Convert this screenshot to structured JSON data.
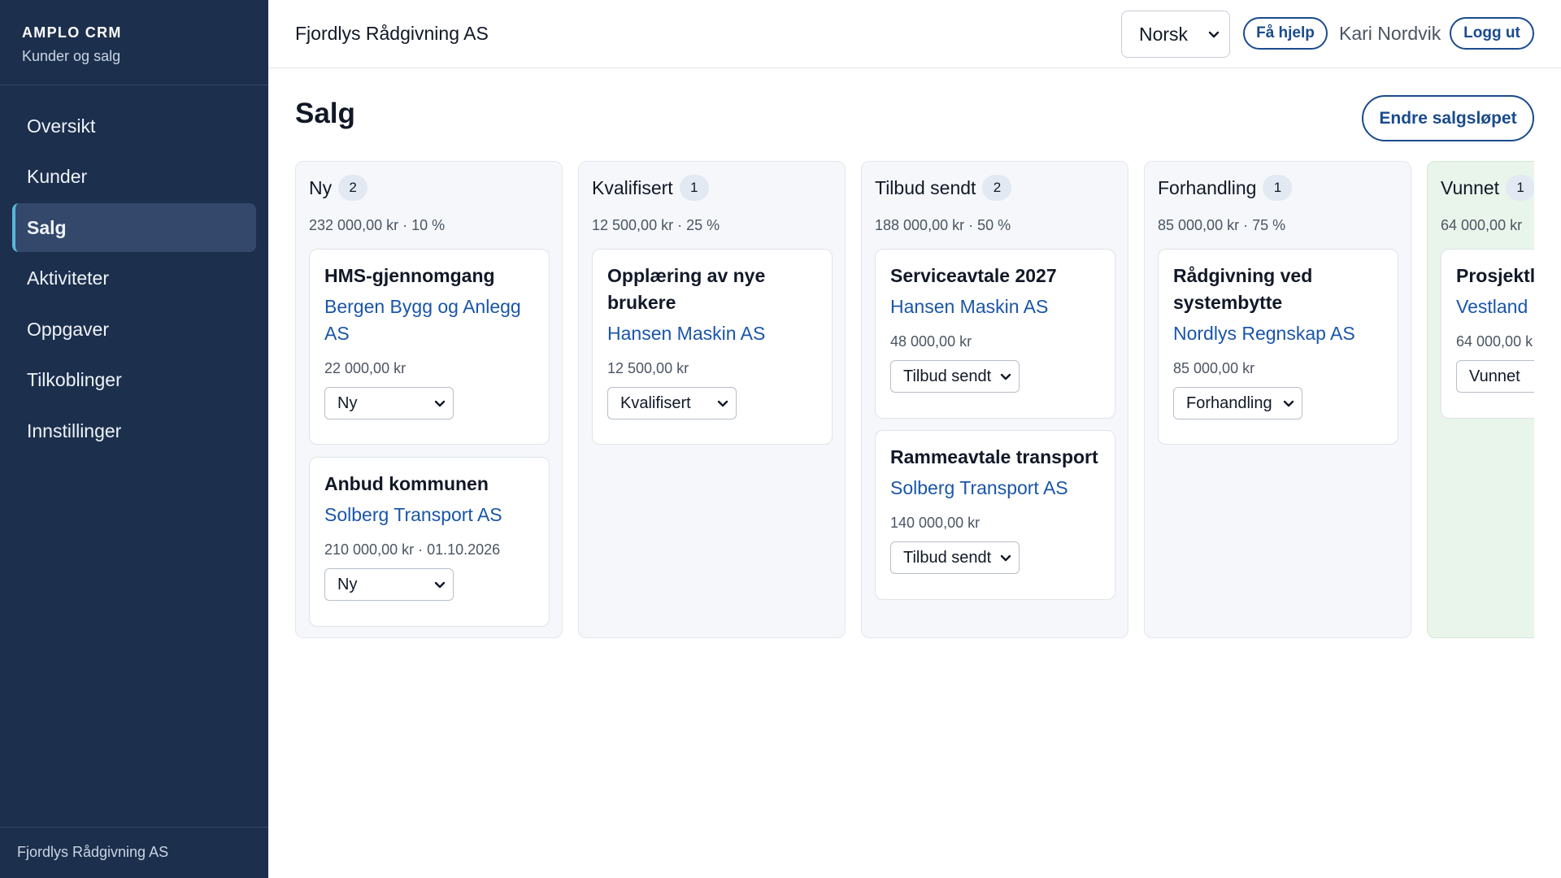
{
  "sidebar": {
    "brand_name": "AMPLO CRM",
    "brand_sub": "Kunder og salg",
    "items": [
      {
        "label": "Oversikt"
      },
      {
        "label": "Kunder"
      },
      {
        "label": "Salg",
        "active": true
      },
      {
        "label": "Aktiviteter"
      },
      {
        "label": "Oppgaver"
      },
      {
        "label": "Tilkoblinger"
      },
      {
        "label": "Innstillinger"
      }
    ],
    "footer": "Fjordlys Rådgivning AS"
  },
  "header": {
    "company": "Fjordlys Rådgivning AS",
    "language": "Norsk",
    "help_label": "Få hjelp",
    "user_name": "Kari Nordvik",
    "logout_label": "Logg ut"
  },
  "main": {
    "title": "Salg",
    "edit_pipeline_label": "Endre salgsløpet"
  },
  "board": {
    "columns": [
      {
        "title": "Ny",
        "count": "2",
        "summary": "232 000,00 kr · 10 %",
        "cards": [
          {
            "title": "HMS-gjennomgang",
            "customer": "Bergen Bygg og Anlegg AS",
            "meta": "22 000,00 kr",
            "stage": "Ny"
          },
          {
            "title": "Anbud kommunen",
            "customer": "Solberg Transport AS",
            "meta": "210 000,00 kr · 01.10.2026",
            "stage": "Ny"
          }
        ]
      },
      {
        "title": "Kvalifisert",
        "count": "1",
        "summary": "12 500,00 kr · 25 %",
        "cards": [
          {
            "title": "Opplæring av nye brukere",
            "customer": "Hansen Maskin AS",
            "meta": "12 500,00 kr",
            "stage": "Kvalifisert"
          }
        ]
      },
      {
        "title": "Tilbud sendt",
        "count": "2",
        "summary": "188 000,00 kr · 50 %",
        "cards": [
          {
            "title": "Serviceavtale 2027",
            "customer": "Hansen Maskin AS",
            "meta": "48 000,00 kr",
            "stage": "Tilbud sendt"
          },
          {
            "title": "Rammeavtale transport",
            "customer": "Solberg Transport AS",
            "meta": "140 000,00 kr",
            "stage": "Tilbud sendt"
          }
        ]
      },
      {
        "title": "Forhandling",
        "count": "1",
        "summary": "85 000,00 kr · 75 %",
        "cards": [
          {
            "title": "Rådgivning ved systembytte",
            "customer": "Nordlys Regnskap AS",
            "meta": "85 000,00 kr",
            "stage": "Forhandling"
          }
        ]
      },
      {
        "title": "Vunnet",
        "count": "1",
        "summary": "64 000,00 kr",
        "cards": [
          {
            "title": "Prosjektle",
            "customer": "Vestland E",
            "meta": "64 000,00 k",
            "stage": "Vunnet"
          }
        ]
      }
    ]
  },
  "colors": {
    "sidebar_bg": "#1c2f4c",
    "accent": "#1a4b8c",
    "link": "#1a56a8",
    "won_column_bg": "#e9f5ea"
  }
}
